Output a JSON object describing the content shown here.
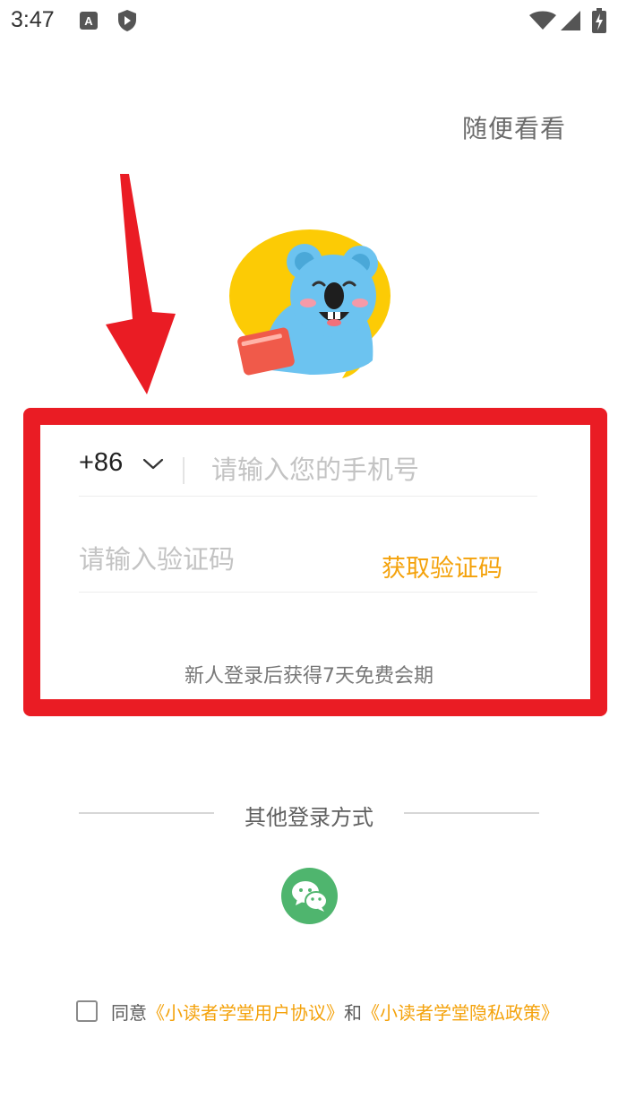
{
  "status_bar": {
    "time": "3:47",
    "app_badge": "A",
    "icons": [
      "app-notification-icon",
      "shield-icon",
      "wifi-icon",
      "signal-icon",
      "battery-charging-icon"
    ]
  },
  "header": {
    "browse_label": "随便看看"
  },
  "login_form": {
    "country_code": "+86",
    "phone_placeholder": "请输入您的手机号",
    "code_placeholder": "请输入验证码",
    "get_code_label": "获取验证码",
    "promo_text": "新人登录后获得7天免费会期"
  },
  "other_login": {
    "label": "其他登录方式",
    "wechat_icon": "wechat-icon"
  },
  "agreement": {
    "prefix": "同意",
    "user_agreement": "《小读者学堂用户协议》",
    "connector": "和",
    "privacy_policy": "《小读者学堂隐私政策》",
    "checked": false
  },
  "colors": {
    "accent": "#f4a20b",
    "annotation": "#ea1c24",
    "wechat": "#4fb56e",
    "mascot_blue": "#6cc3f0",
    "mascot_yellow": "#fccb05"
  }
}
